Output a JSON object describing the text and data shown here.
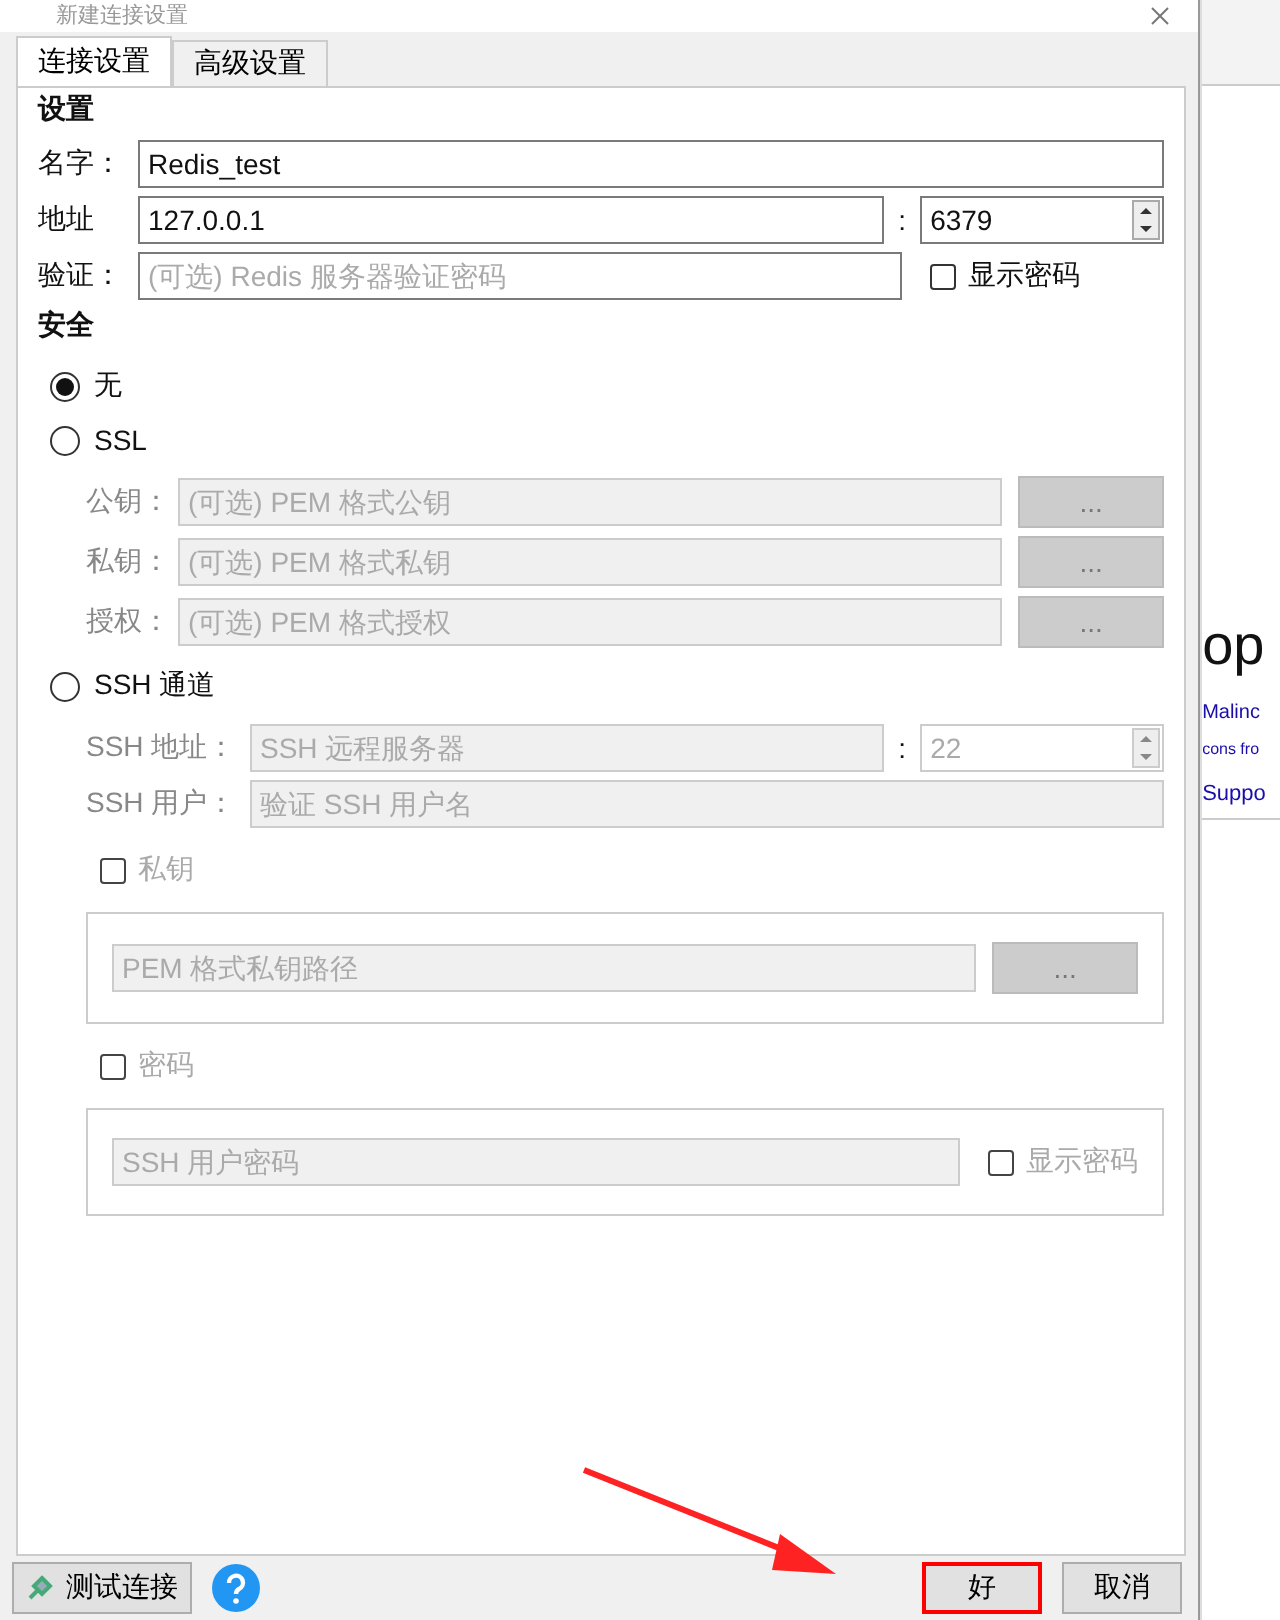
{
  "window": {
    "title": "新建连接设置"
  },
  "tabs": [
    {
      "label": "连接设置",
      "selected": true
    },
    {
      "label": "高级设置",
      "selected": false
    }
  ],
  "settings": {
    "heading": "设置",
    "name": {
      "label": "名字：",
      "value": "Redis_test"
    },
    "address": {
      "label": "地址",
      "value": "127.0.0.1",
      "separator": ":",
      "port": "6379"
    },
    "auth": {
      "label": "验证：",
      "placeholder": "(可选) Redis 服务器验证密码",
      "show_password": {
        "label": "显示密码",
        "checked": false
      }
    }
  },
  "security": {
    "heading": "安全",
    "options": [
      {
        "label": "无",
        "selected": true
      },
      {
        "label": "SSL",
        "selected": false
      },
      {
        "label": "SSH 通道",
        "selected": false
      }
    ],
    "ssl": {
      "disabled": true,
      "fields": [
        {
          "label": "公钥：",
          "placeholder": "(可选) PEM 格式公钥",
          "button": "..."
        },
        {
          "label": "私钥：",
          "placeholder": "(可选) PEM 格式私钥",
          "button": "..."
        },
        {
          "label": "授权：",
          "placeholder": "(可选) PEM 格式授权",
          "button": "..."
        }
      ]
    },
    "ssh": {
      "disabled": true,
      "address": {
        "label": "SSH 地址：",
        "placeholder": "SSH 远程服务器",
        "separator": ":",
        "port": "22"
      },
      "user": {
        "label": "SSH 用户：",
        "placeholder": "验证 SSH 用户名"
      },
      "private_key": {
        "label": "私钥",
        "checked": false,
        "placeholder": "PEM 格式私钥路径",
        "button": "..."
      },
      "password": {
        "label": "密码",
        "checked": false,
        "placeholder": "SSH 用户密码",
        "show_password": {
          "label": "显示密码",
          "checked": false
        }
      }
    }
  },
  "footer": {
    "test_button": "测试连接",
    "ok_button": {
      "label": "好",
      "highlighted": true
    },
    "cancel_button": "取消"
  },
  "background_window": {
    "texts": [
      "op",
      "Malinc",
      "cons fro",
      "Suppo"
    ]
  }
}
